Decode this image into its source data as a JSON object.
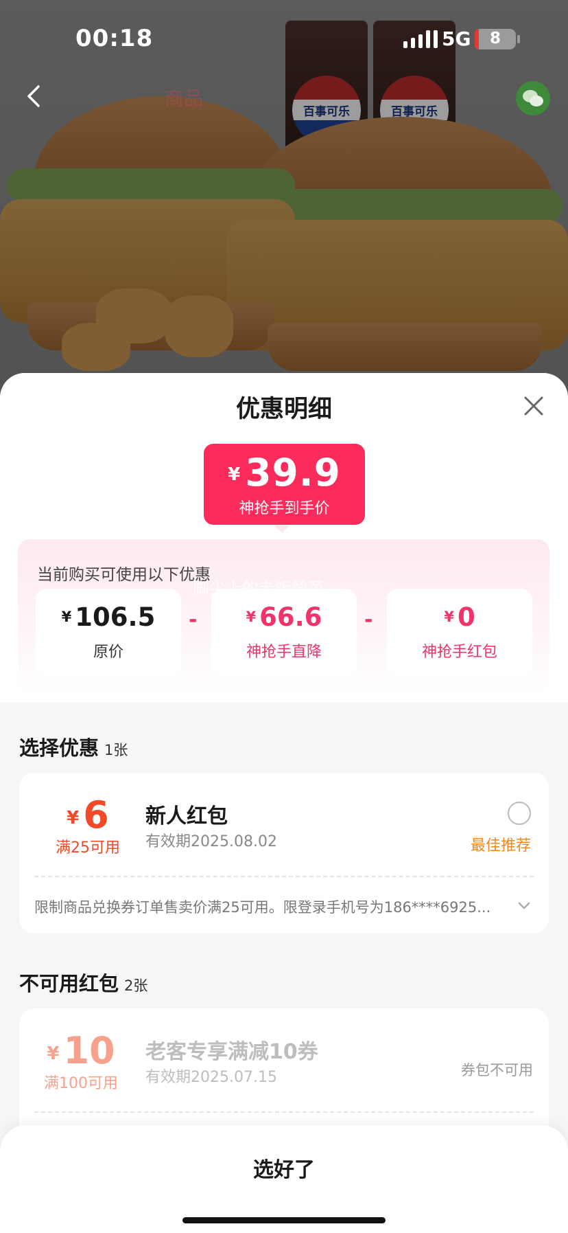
{
  "status_bar": {
    "time": "00:18",
    "network": "5G",
    "battery": "8",
    "battery_level_fraction": 0.08
  },
  "nav": {
    "back_icon": "chevron-left-icon",
    "title": "商品",
    "share_icon": "wechat-icon"
  },
  "product_photo": {
    "brand_text": "百事可乐"
  },
  "sheet": {
    "title": "优惠明细",
    "close_icon": "close-icon",
    "final_price": {
      "currency": "¥",
      "amount": "39.9",
      "label": "神抢手到手价"
    },
    "breakdown": {
      "intro": "当前购买可使用以下优惠",
      "watermark": "脚尖上的老饭酸菜",
      "items": [
        {
          "currency": "¥",
          "amount": "106.5",
          "label": "原价"
        },
        {
          "currency": "¥",
          "amount": "66.6",
          "label": "神抢手直降"
        },
        {
          "currency": "¥",
          "amount": "0",
          "label": "神抢手红包"
        }
      ],
      "operator": "-"
    },
    "select_section": {
      "title": "选择优惠",
      "count": "1张"
    },
    "coupon_available": {
      "currency": "¥",
      "amount": "6",
      "condition": "满25可用",
      "name": "新人红包",
      "expiry": "有效期2025.08.02",
      "recommend": "最佳推荐",
      "rule": "限制商品兑换券订单售卖价满25可用。限登录手机号为186****6925...",
      "selected": false
    },
    "unavailable_section": {
      "title": "不可用红包",
      "count": "2张"
    },
    "coupon_unavailable": {
      "currency": "¥",
      "amount": "10",
      "condition": "满100可用",
      "name": "老客专享满减10券",
      "expiry": "有效期2025.07.15",
      "status": "券包不可用"
    },
    "confirm_button": "选好了"
  },
  "colors": {
    "accent": "#fb2b5c",
    "coupon_orange": "#f04a28",
    "recommend": "#f08a1d"
  }
}
